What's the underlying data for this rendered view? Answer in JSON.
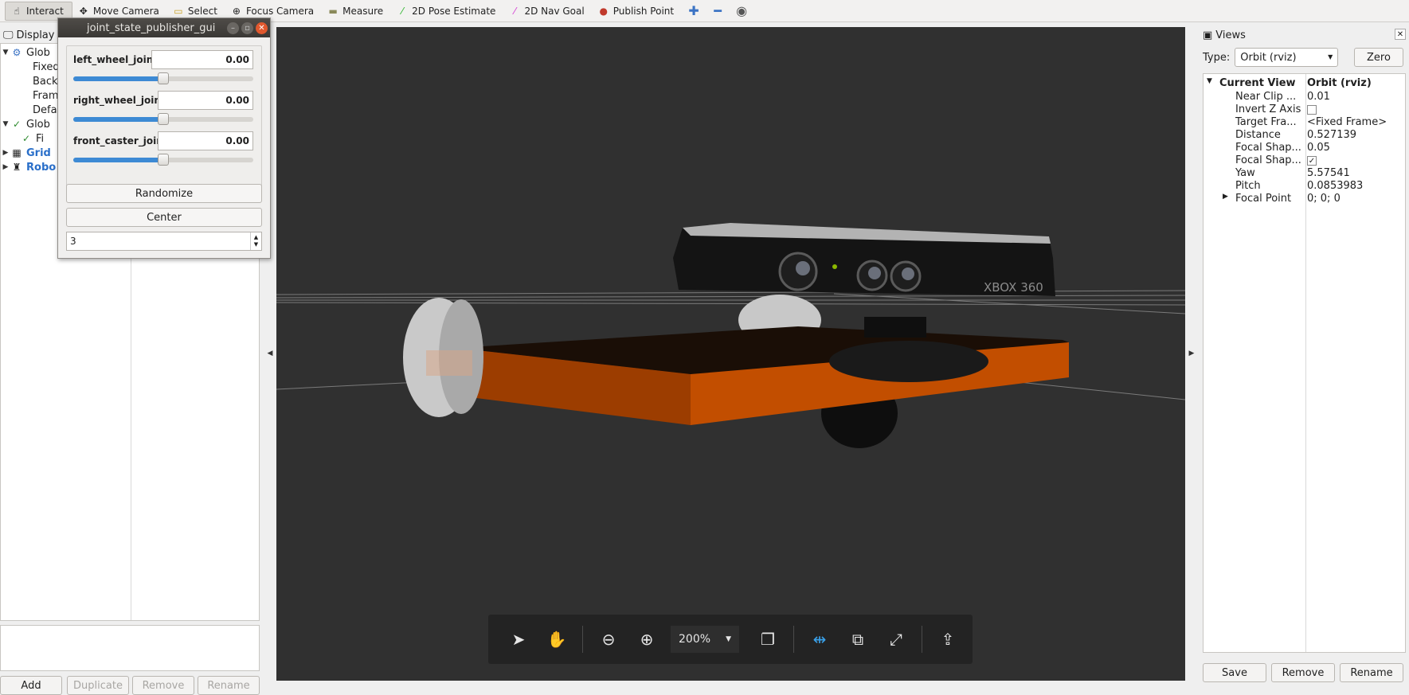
{
  "toolbar": {
    "tools": [
      {
        "label": "Interact",
        "icon": "interact-icon",
        "active": true
      },
      {
        "label": "Move Camera",
        "icon": "move-camera-icon"
      },
      {
        "label": "Select",
        "icon": "select-icon"
      },
      {
        "label": "Focus Camera",
        "icon": "focus-camera-icon"
      },
      {
        "label": "Measure",
        "icon": "measure-icon"
      },
      {
        "label": "2D Pose Estimate",
        "icon": "pose-estimate-icon"
      },
      {
        "label": "2D Nav Goal",
        "icon": "nav-goal-icon"
      },
      {
        "label": "Publish Point",
        "icon": "publish-point-icon"
      }
    ]
  },
  "displays": {
    "title": "Display",
    "tree": [
      {
        "label": "Glob",
        "icon": "globe-icon",
        "expanded": true
      },
      {
        "label": "Fixed"
      },
      {
        "label": "Back"
      },
      {
        "label": "Fram"
      },
      {
        "label": "Defa"
      },
      {
        "label": "Glob",
        "check": true,
        "expanded": true
      },
      {
        "label": "Fi",
        "check": true
      },
      {
        "label": "Grid",
        "icon": "grid-icon"
      },
      {
        "label": "Robo",
        "icon": "robot-model-icon"
      }
    ],
    "buttons": {
      "add": "Add",
      "duplicate": "Duplicate",
      "remove": "Remove",
      "rename": "Rename"
    }
  },
  "joint_gui": {
    "title": "joint_state_publisher_gui",
    "joints": [
      {
        "name": "left_wheel_joint",
        "value": "0.00",
        "slider_fraction": 0.5
      },
      {
        "name": "right_wheel_joint",
        "value": "0.00",
        "slider_fraction": 0.5
      },
      {
        "name": "front_caster_joint",
        "value": "0.00",
        "slider_fraction": 0.5
      }
    ],
    "randomize": "Randomize",
    "center": "Center",
    "spin_value": "3"
  },
  "viewport": {
    "device_label": "XBOX 360",
    "zoom": "200%",
    "colors": {
      "background": "#303030",
      "base": "#c24e00",
      "wheel": "#c9c9c9"
    }
  },
  "views": {
    "title": "Views",
    "type_label": "Type:",
    "type_value": "Orbit (rviz)",
    "zero": "Zero",
    "current_view_name": "Current View",
    "current_view_value": "Orbit (rviz)",
    "props": [
      {
        "name": "Near Clip ...",
        "value": "0.01"
      },
      {
        "name": "Invert Z Axis",
        "checkbox": false
      },
      {
        "name": "Target Fra...",
        "value": "<Fixed Frame>"
      },
      {
        "name": "Distance",
        "value": "0.527139"
      },
      {
        "name": "Focal Shap...",
        "value": "0.05"
      },
      {
        "name": "Focal Shap...",
        "checkbox": true
      },
      {
        "name": "Yaw",
        "value": "5.57541"
      },
      {
        "name": "Pitch",
        "value": "0.0853983"
      },
      {
        "name": "Focal Point",
        "value": "0; 0; 0"
      }
    ],
    "buttons": {
      "save": "Save",
      "remove": "Remove",
      "rename": "Rename"
    }
  }
}
